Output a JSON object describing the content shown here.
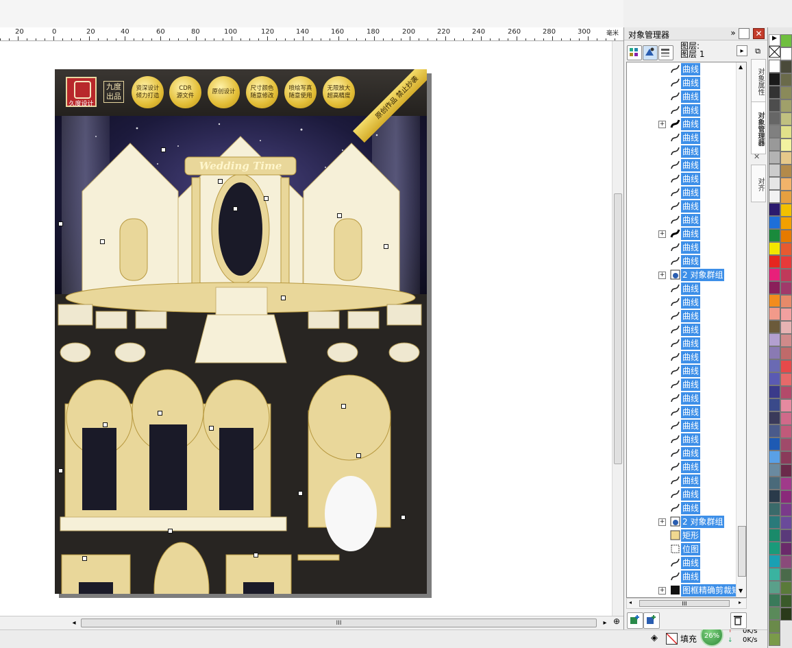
{
  "ruler": {
    "labels": [
      "20",
      "0",
      "20",
      "40",
      "60",
      "80",
      "100",
      "120",
      "140",
      "160",
      "180",
      "200",
      "220",
      "240",
      "260",
      "280",
      "300"
    ],
    "unit": "毫米"
  },
  "document": {
    "header": {
      "logo_text": "久度设计",
      "brand": "九度出品",
      "badges": [
        "资深设计\n倾力打造",
        "CDR\n源文件",
        "原创设计",
        "尺寸颜色\n随意修改",
        "喷绘写真\n随意使用",
        "无限放大\n超高精度"
      ],
      "ribbon": "原创作品 禁止抄袭"
    },
    "banner_text": "Wedding Time"
  },
  "hscroll": {
    "thumb_label": "III"
  },
  "docker": {
    "title": "对象管理器",
    "layer_heading": "图层:",
    "layer_name": "图层 1",
    "side_tabs": [
      "对象属性",
      "对象管理器",
      "对齐"
    ],
    "tree_items": [
      {
        "label": "曲线",
        "type": "curve"
      },
      {
        "label": "曲线",
        "type": "curve"
      },
      {
        "label": "曲线",
        "type": "curve"
      },
      {
        "label": "曲线",
        "type": "curve"
      },
      {
        "label": "曲线",
        "type": "curve-bold",
        "expandable": true
      },
      {
        "label": "曲线",
        "type": "curve"
      },
      {
        "label": "曲线",
        "type": "curve"
      },
      {
        "label": "曲线",
        "type": "curve"
      },
      {
        "label": "曲线",
        "type": "curve"
      },
      {
        "label": "曲线",
        "type": "curve"
      },
      {
        "label": "曲线",
        "type": "curve"
      },
      {
        "label": "曲线",
        "type": "curve"
      },
      {
        "label": "曲线",
        "type": "curve-bold",
        "expandable": true
      },
      {
        "label": "曲线",
        "type": "curve"
      },
      {
        "label": "曲线",
        "type": "curve"
      },
      {
        "label": "2 对象群组",
        "type": "group",
        "expandable": true
      },
      {
        "label": "曲线",
        "type": "curve"
      },
      {
        "label": "曲线",
        "type": "curve"
      },
      {
        "label": "曲线",
        "type": "curve"
      },
      {
        "label": "曲线",
        "type": "curve"
      },
      {
        "label": "曲线",
        "type": "curve"
      },
      {
        "label": "曲线",
        "type": "curve"
      },
      {
        "label": "曲线",
        "type": "curve"
      },
      {
        "label": "曲线",
        "type": "curve"
      },
      {
        "label": "曲线",
        "type": "curve"
      },
      {
        "label": "曲线",
        "type": "curve"
      },
      {
        "label": "曲线",
        "type": "curve"
      },
      {
        "label": "曲线",
        "type": "curve"
      },
      {
        "label": "曲线",
        "type": "curve"
      },
      {
        "label": "曲线",
        "type": "curve"
      },
      {
        "label": "曲线",
        "type": "curve"
      },
      {
        "label": "曲线",
        "type": "curve"
      },
      {
        "label": "曲线",
        "type": "curve"
      },
      {
        "label": "2 对象群组",
        "type": "group",
        "expandable": true
      },
      {
        "label": "矩形",
        "type": "rect"
      },
      {
        "label": "位图",
        "type": "bitmap"
      },
      {
        "label": "曲线",
        "type": "curve"
      },
      {
        "label": "曲线",
        "type": "curve"
      },
      {
        "label": "图框精确剪裁矩",
        "type": "powerclip",
        "expandable": true
      }
    ]
  },
  "status": {
    "fill_label": "填充",
    "cpu_percent": "26%",
    "net_up": "0K/s",
    "net_down": "0K/s"
  },
  "palette": {
    "col1": [
      "#ffffff",
      "#1a1a1a",
      "#333333",
      "#4d4d4d",
      "#666666",
      "#808080",
      "#999999",
      "#b3b3b3",
      "#cccccc",
      "#e6e6e6",
      "#f2f2f2",
      "#2b1a6e",
      "#1e6fd9",
      "#1a8a3c",
      "#f2e600",
      "#e6261f",
      "#e8207a",
      "#8a1f5a",
      "#f28c1e",
      "#f29a8a",
      "#6b5a3a",
      "#b3a0d0",
      "#8a7ab3",
      "#6a6ab3",
      "#5a5ab3",
      "#3a3a8a",
      "#3a4a8a",
      "#3a3a5a",
      "#4a5a8a",
      "#1e5ab3",
      "#5aa0e6",
      "#6a8aa0",
      "#4a6a7a",
      "#2a3a4a",
      "#3a6a6a",
      "#2a7a7a",
      "#1a8a6a",
      "#1a9a7a",
      "#1aa0b3",
      "#3ab3a0",
      "#5aa08a",
      "#3a7a5a",
      "#5a8a5a",
      "#6a8a4a",
      "#7a9a4a"
    ],
    "col2": [
      "#6fbf3f",
      "#ffffff",
      "#4a4a3a",
      "#6a6a4a",
      "#8a8a5a",
      "#a0a06a",
      "#c0c080",
      "#e0e08a",
      "#f2f2a0",
      "#e6c88a",
      "#b38a4a",
      "#f2b36a",
      "#e6a040",
      "#f2c000",
      "#f2a000",
      "#e67a00",
      "#e65a30",
      "#e63a3a",
      "#c03a5a",
      "#a03a6a",
      "#e68a6a",
      "#f2a0a0",
      "#e6b3b3",
      "#d08a8a",
      "#c06a6a",
      "#e64a4a",
      "#e66a6a",
      "#b34a6a",
      "#e68aa0",
      "#d06a8a",
      "#c05a7a",
      "#a04a6a",
      "#8a3a5a",
      "#6a2a4a",
      "#a03a8a",
      "#8a2a7a",
      "#7a3a8a",
      "#6a4a9a",
      "#5a3a7a",
      "#6a2a6a",
      "#8a4a7a",
      "#4a6a4a",
      "#5a7a3a",
      "#3a5a2a",
      "#2a3a1a"
    ]
  }
}
